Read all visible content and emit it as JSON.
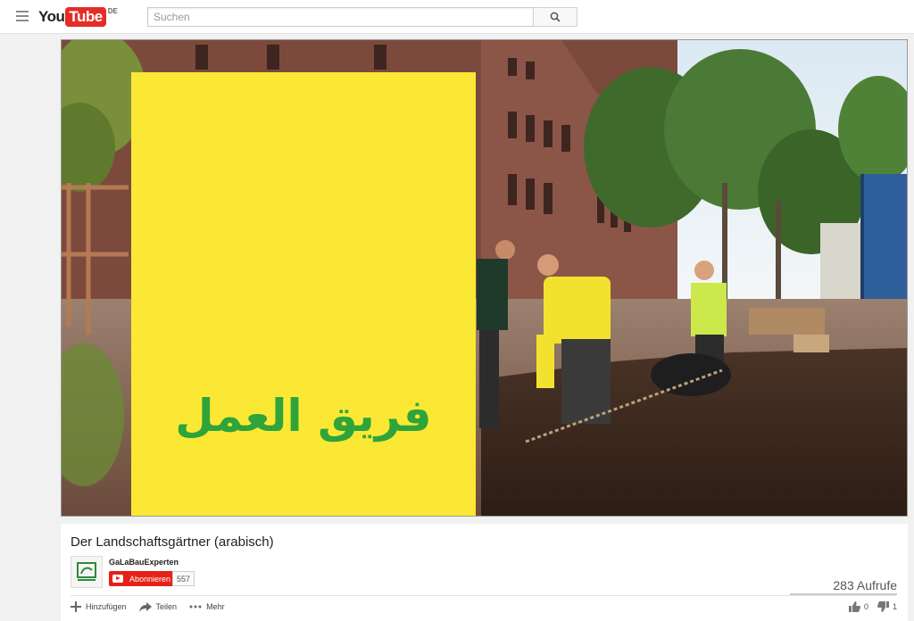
{
  "masthead": {
    "logo_you": "You",
    "logo_tube": "Tube",
    "country": "DE",
    "search_placeholder": "Suchen"
  },
  "player": {
    "overlay_text": "فريق العمل"
  },
  "video": {
    "title": "Der Landschaftsgärtner (arabisch)",
    "channel_name": "GaLaBauExperten",
    "subscribe_label": "Abonnieren",
    "subscriber_count": "557",
    "views": "283 Aufrufe",
    "actions": [
      {
        "label": "Hinzufügen",
        "icon": "add-icon"
      },
      {
        "label": "Teilen",
        "icon": "share-icon"
      },
      {
        "label": "Mehr",
        "icon": "more-icon"
      }
    ],
    "likes": "0",
    "dislikes": "1"
  },
  "colors": {
    "brand_red": "#e52d27",
    "overlay_yellow": "#fbe834",
    "overlay_text_green": "#2ea43a"
  }
}
